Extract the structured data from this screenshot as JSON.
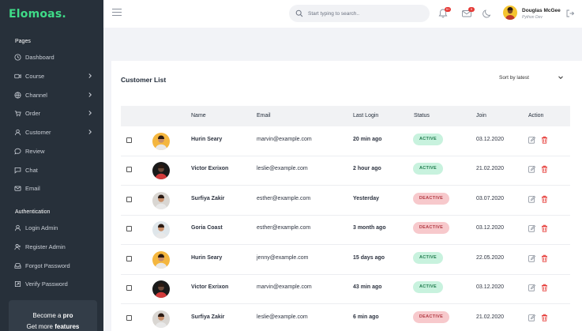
{
  "app": {
    "logo": "Elomoas."
  },
  "sidebar": {
    "pages_title": "Pages",
    "items": [
      {
        "label": "Dashboard",
        "icon": "clock-icon",
        "chevron": false
      },
      {
        "label": "Course",
        "icon": "video-icon",
        "chevron": true
      },
      {
        "label": "Channel",
        "icon": "globe-icon",
        "chevron": true
      },
      {
        "label": "Order",
        "icon": "cart-icon",
        "chevron": true
      },
      {
        "label": "Customer",
        "icon": "user-icon",
        "chevron": true
      },
      {
        "label": "Review",
        "icon": "chat-bubble-icon",
        "chevron": false
      },
      {
        "label": "Chat",
        "icon": "message-square-icon",
        "chevron": false
      },
      {
        "label": "Email",
        "icon": "mail-icon",
        "chevron": false
      }
    ],
    "auth_title": "Authentication",
    "auth_items": [
      {
        "label": "Login Admin",
        "icon": "user-icon"
      },
      {
        "label": "Register Admin",
        "icon": "user-plus-icon"
      },
      {
        "label": "Forgot Password",
        "icon": "inbox-icon"
      },
      {
        "label": "Verify Password",
        "icon": "arrow-up-right-icon"
      }
    ],
    "promo": {
      "line1_prefix": "Become a ",
      "line1_bold": "pro",
      "line2_prefix": "Get more ",
      "line2_bold": "features"
    }
  },
  "header": {
    "search_placeholder": "Start typing to search..",
    "notif_count": "9+",
    "mail_count": "9",
    "user_name": "Douglas McGee",
    "user_role": "Python Dev"
  },
  "customers": {
    "title": "Customer List",
    "sort_label": "Sort by latest",
    "columns": [
      "Name",
      "Email",
      "Last Login",
      "Status",
      "Join",
      "Action"
    ],
    "rows": [
      {
        "name": "Hurin Seary",
        "email": "marvin@example.com",
        "last_login": "20 min ago",
        "status": "ACTIVE",
        "join": "03.12.2020",
        "avatar_bg": "#f4b63f"
      },
      {
        "name": "Victor Exrixon",
        "email": "leslie@example.com",
        "last_login": "2 hour ago",
        "status": "ACTIVE",
        "join": "21.02.2020",
        "avatar_bg": "#1a1a1a"
      },
      {
        "name": "Surfiya Zakir",
        "email": "esther@example.com",
        "last_login": "Yesterday",
        "status": "DEACTIVE",
        "join": "03.07.2020",
        "avatar_bg": "#d9d6d2"
      },
      {
        "name": "Goria Coast",
        "email": "esther@example.com",
        "last_login": "3 month ago",
        "status": "DEACTIVE",
        "join": "03.12.2020",
        "avatar_bg": "#dfe6ea"
      },
      {
        "name": "Hurin Seary",
        "email": "jenny@example.com",
        "last_login": "15 days ago",
        "status": "ACTIVE",
        "join": "22.05.2020",
        "avatar_bg": "#f4b63f"
      },
      {
        "name": "Victor Exrixon",
        "email": "marvin@example.com",
        "last_login": "43 min ago",
        "status": "ACTIVE",
        "join": "03.12.2020",
        "avatar_bg": "#1a1a1a"
      },
      {
        "name": "Surfiya Zakir",
        "email": "leslie@example.com",
        "last_login": "6 min ago",
        "status": "DEACTIVE",
        "join": "21.02.2020",
        "avatar_bg": "#d9d6d2"
      }
    ]
  },
  "colors": {
    "sidebar_bg": "#27303a",
    "brand": "#3fdc88",
    "active_badge": "#c8f2de",
    "deactive_badge": "#f7c9cc",
    "delete": "#e53935",
    "edit": "#8a919c"
  }
}
